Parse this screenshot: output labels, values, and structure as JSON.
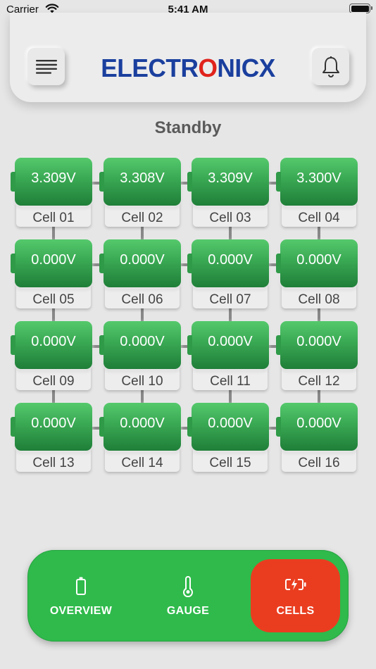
{
  "status_bar": {
    "carrier": "Carrier",
    "time": "5:41 AM"
  },
  "header": {
    "logo_pre": "ELECTR",
    "logo_o": "O",
    "logo_post": "NICX",
    "menu_icon": "menu-icon",
    "bell_icon": "bell-icon"
  },
  "mode": "Standby",
  "cells": [
    {
      "label": "Cell 01",
      "voltage": "3.309V"
    },
    {
      "label": "Cell 02",
      "voltage": "3.308V"
    },
    {
      "label": "Cell 03",
      "voltage": "3.309V"
    },
    {
      "label": "Cell 04",
      "voltage": "3.300V"
    },
    {
      "label": "Cell 05",
      "voltage": "0.000V"
    },
    {
      "label": "Cell 06",
      "voltage": "0.000V"
    },
    {
      "label": "Cell 07",
      "voltage": "0.000V"
    },
    {
      "label": "Cell 08",
      "voltage": "0.000V"
    },
    {
      "label": "Cell 09",
      "voltage": "0.000V"
    },
    {
      "label": "Cell 10",
      "voltage": "0.000V"
    },
    {
      "label": "Cell 11",
      "voltage": "0.000V"
    },
    {
      "label": "Cell 12",
      "voltage": "0.000V"
    },
    {
      "label": "Cell 13",
      "voltage": "0.000V"
    },
    {
      "label": "Cell 14",
      "voltage": "0.000V"
    },
    {
      "label": "Cell 15",
      "voltage": "0.000V"
    },
    {
      "label": "Cell 16",
      "voltage": "0.000V"
    }
  ],
  "nav": {
    "overview": "OVERVIEW",
    "gauge": "GAUGE",
    "cells": "CELLS",
    "active": "cells"
  },
  "colors": {
    "cell_green": "#39a853",
    "nav_green": "#2fba4b",
    "active_tab": "#ea3d20",
    "logo_blue": "#1a3f9e",
    "logo_red": "#e0231c"
  }
}
